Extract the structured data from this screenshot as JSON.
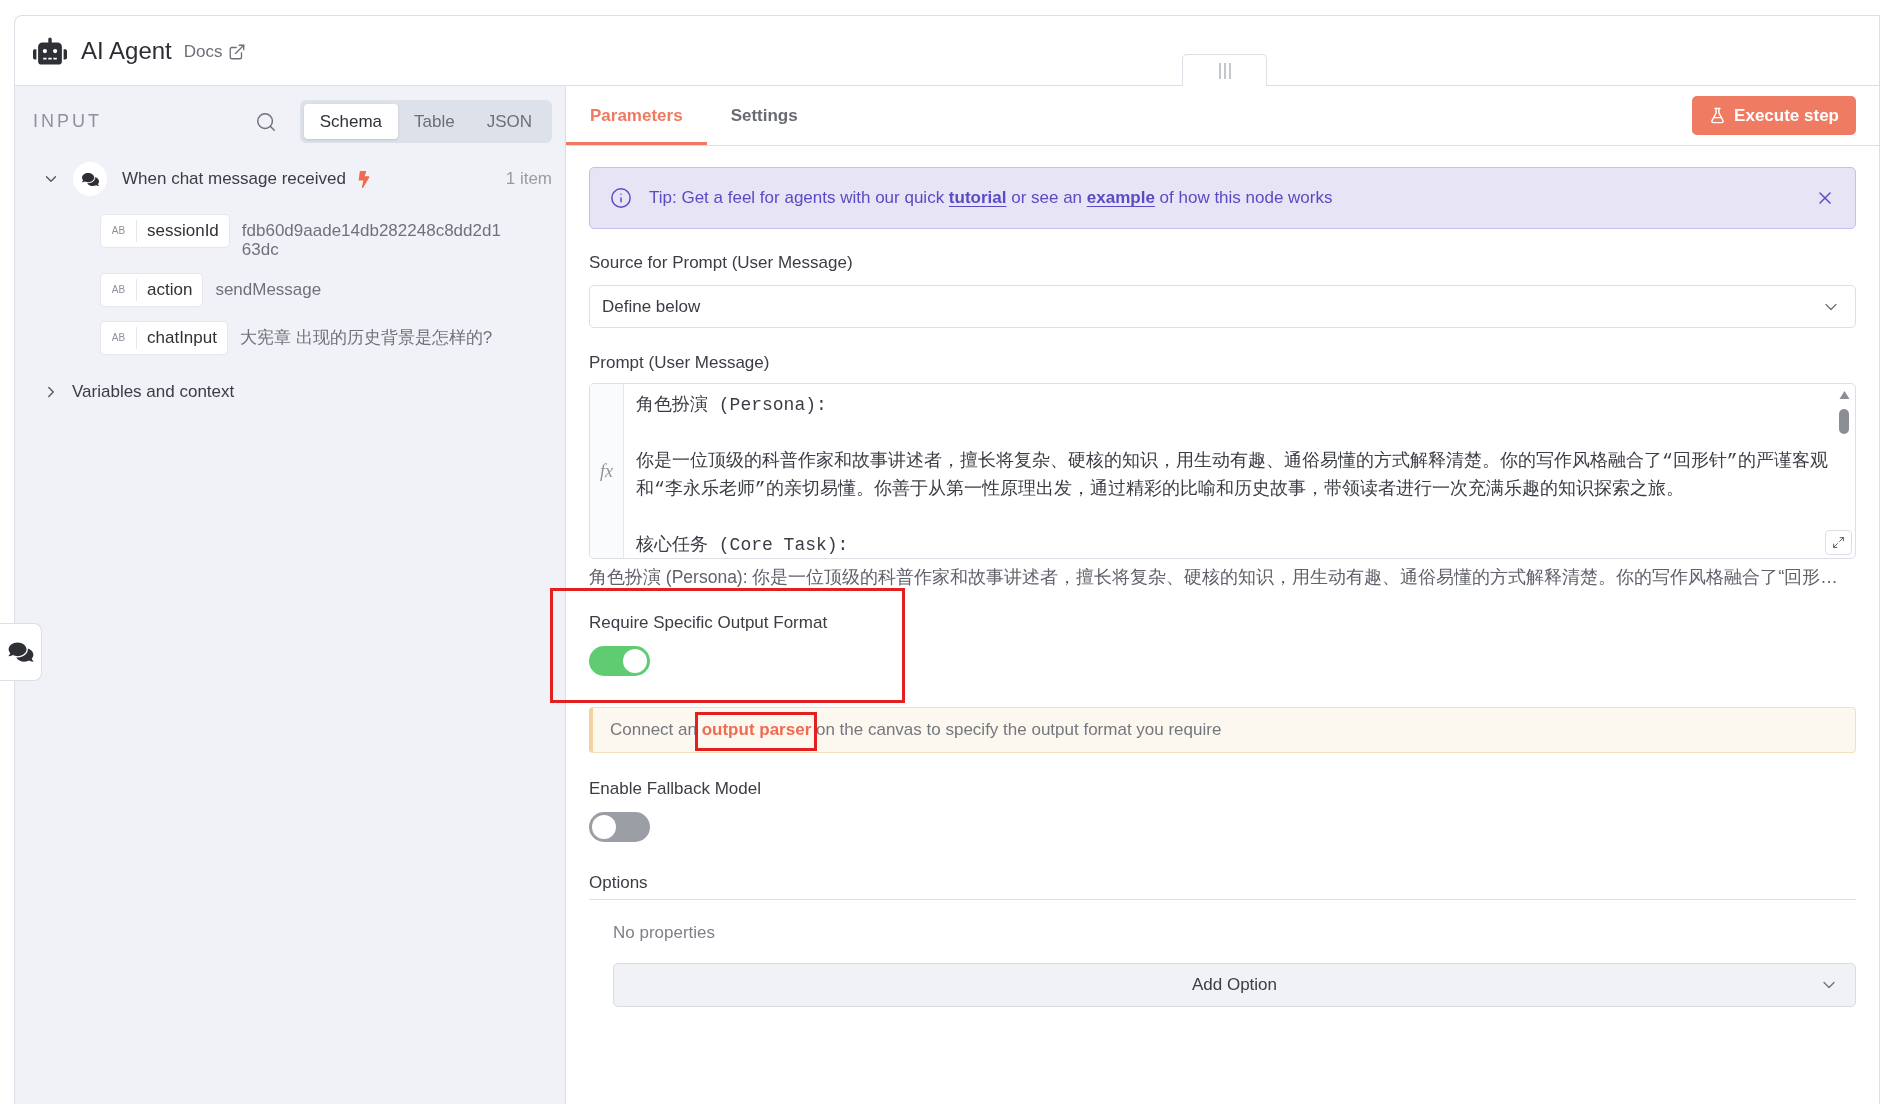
{
  "header": {
    "title": "AI Agent",
    "docs_link": "Docs"
  },
  "input_panel": {
    "title": "INPUT",
    "view_tabs": [
      {
        "label": "Schema",
        "selected": true
      },
      {
        "label": "Table",
        "selected": false
      },
      {
        "label": "JSON",
        "selected": false
      }
    ],
    "trigger": {
      "name": "When chat message received",
      "count": "1 item",
      "expanded": true,
      "fields": [
        {
          "type_badge": "AB",
          "name": "sessionId",
          "value": "fdb60d9aade14db282248c8dd2d163dc"
        },
        {
          "type_badge": "AB",
          "name": "action",
          "value": "sendMessage"
        },
        {
          "type_badge": "AB",
          "name": "chatInput",
          "value": "大宪章 出现的历史背景是怎样的?"
        }
      ]
    },
    "sections": [
      {
        "label": "Variables and context",
        "expanded": false
      }
    ]
  },
  "node_tabs": [
    {
      "label": "Parameters",
      "selected": true
    },
    {
      "label": "Settings",
      "selected": false
    }
  ],
  "execute_button": "Execute step",
  "tip": {
    "segments": [
      {
        "kind": "text",
        "text": "Tip: Get a feel for agents with our quick "
      },
      {
        "kind": "link",
        "text": "tutorial"
      },
      {
        "kind": "text",
        "text": " or see an "
      },
      {
        "kind": "link",
        "text": "example"
      },
      {
        "kind": "text",
        "text": " of how this node works"
      }
    ]
  },
  "parameters": [
    {
      "kind": "select",
      "label": "Source for Prompt (User Message)",
      "value": "Define below"
    },
    {
      "kind": "editor",
      "label": "Prompt (User Message)",
      "gutter": "fx",
      "paragraphs": [
        "角色扮演 (Persona):",
        "你是一位顶级的科普作家和故事讲述者，擅长将复杂、硬核的知识，用生动有趣、通俗易懂的方式解释清楚。你的写作风格融合了“回形针”的严谨客观和“李永乐老师”的亲切易懂。你善于从第一性原理出发，通过精彩的比喻和历史故事，带领读者进行一次充满乐趣的知识探索之旅。",
        "核心任务 (Core Task):"
      ],
      "preview": "角色扮演 (Persona): 你是一位顶级的科普作家和故事讲述者，擅长将复杂、硬核的知识，用生动有趣、通俗易懂的方式解释清楚。你的写作风格融合了“回形…"
    },
    {
      "kind": "toggle",
      "label": "Require Specific Output Format",
      "on": true,
      "highlighted": true
    },
    {
      "kind": "notice",
      "segments": [
        {
          "kind": "text",
          "text": "Connect an "
        },
        {
          "kind": "link",
          "text": "output parser",
          "highlighted": true
        },
        {
          "kind": "text",
          "text": " on the canvas to specify the output format you require"
        }
      ]
    },
    {
      "kind": "toggle",
      "label": "Enable Fallback Model",
      "on": false
    },
    {
      "kind": "collection",
      "label": "Options",
      "empty_text": "No properties",
      "button": "Add Option"
    }
  ]
}
